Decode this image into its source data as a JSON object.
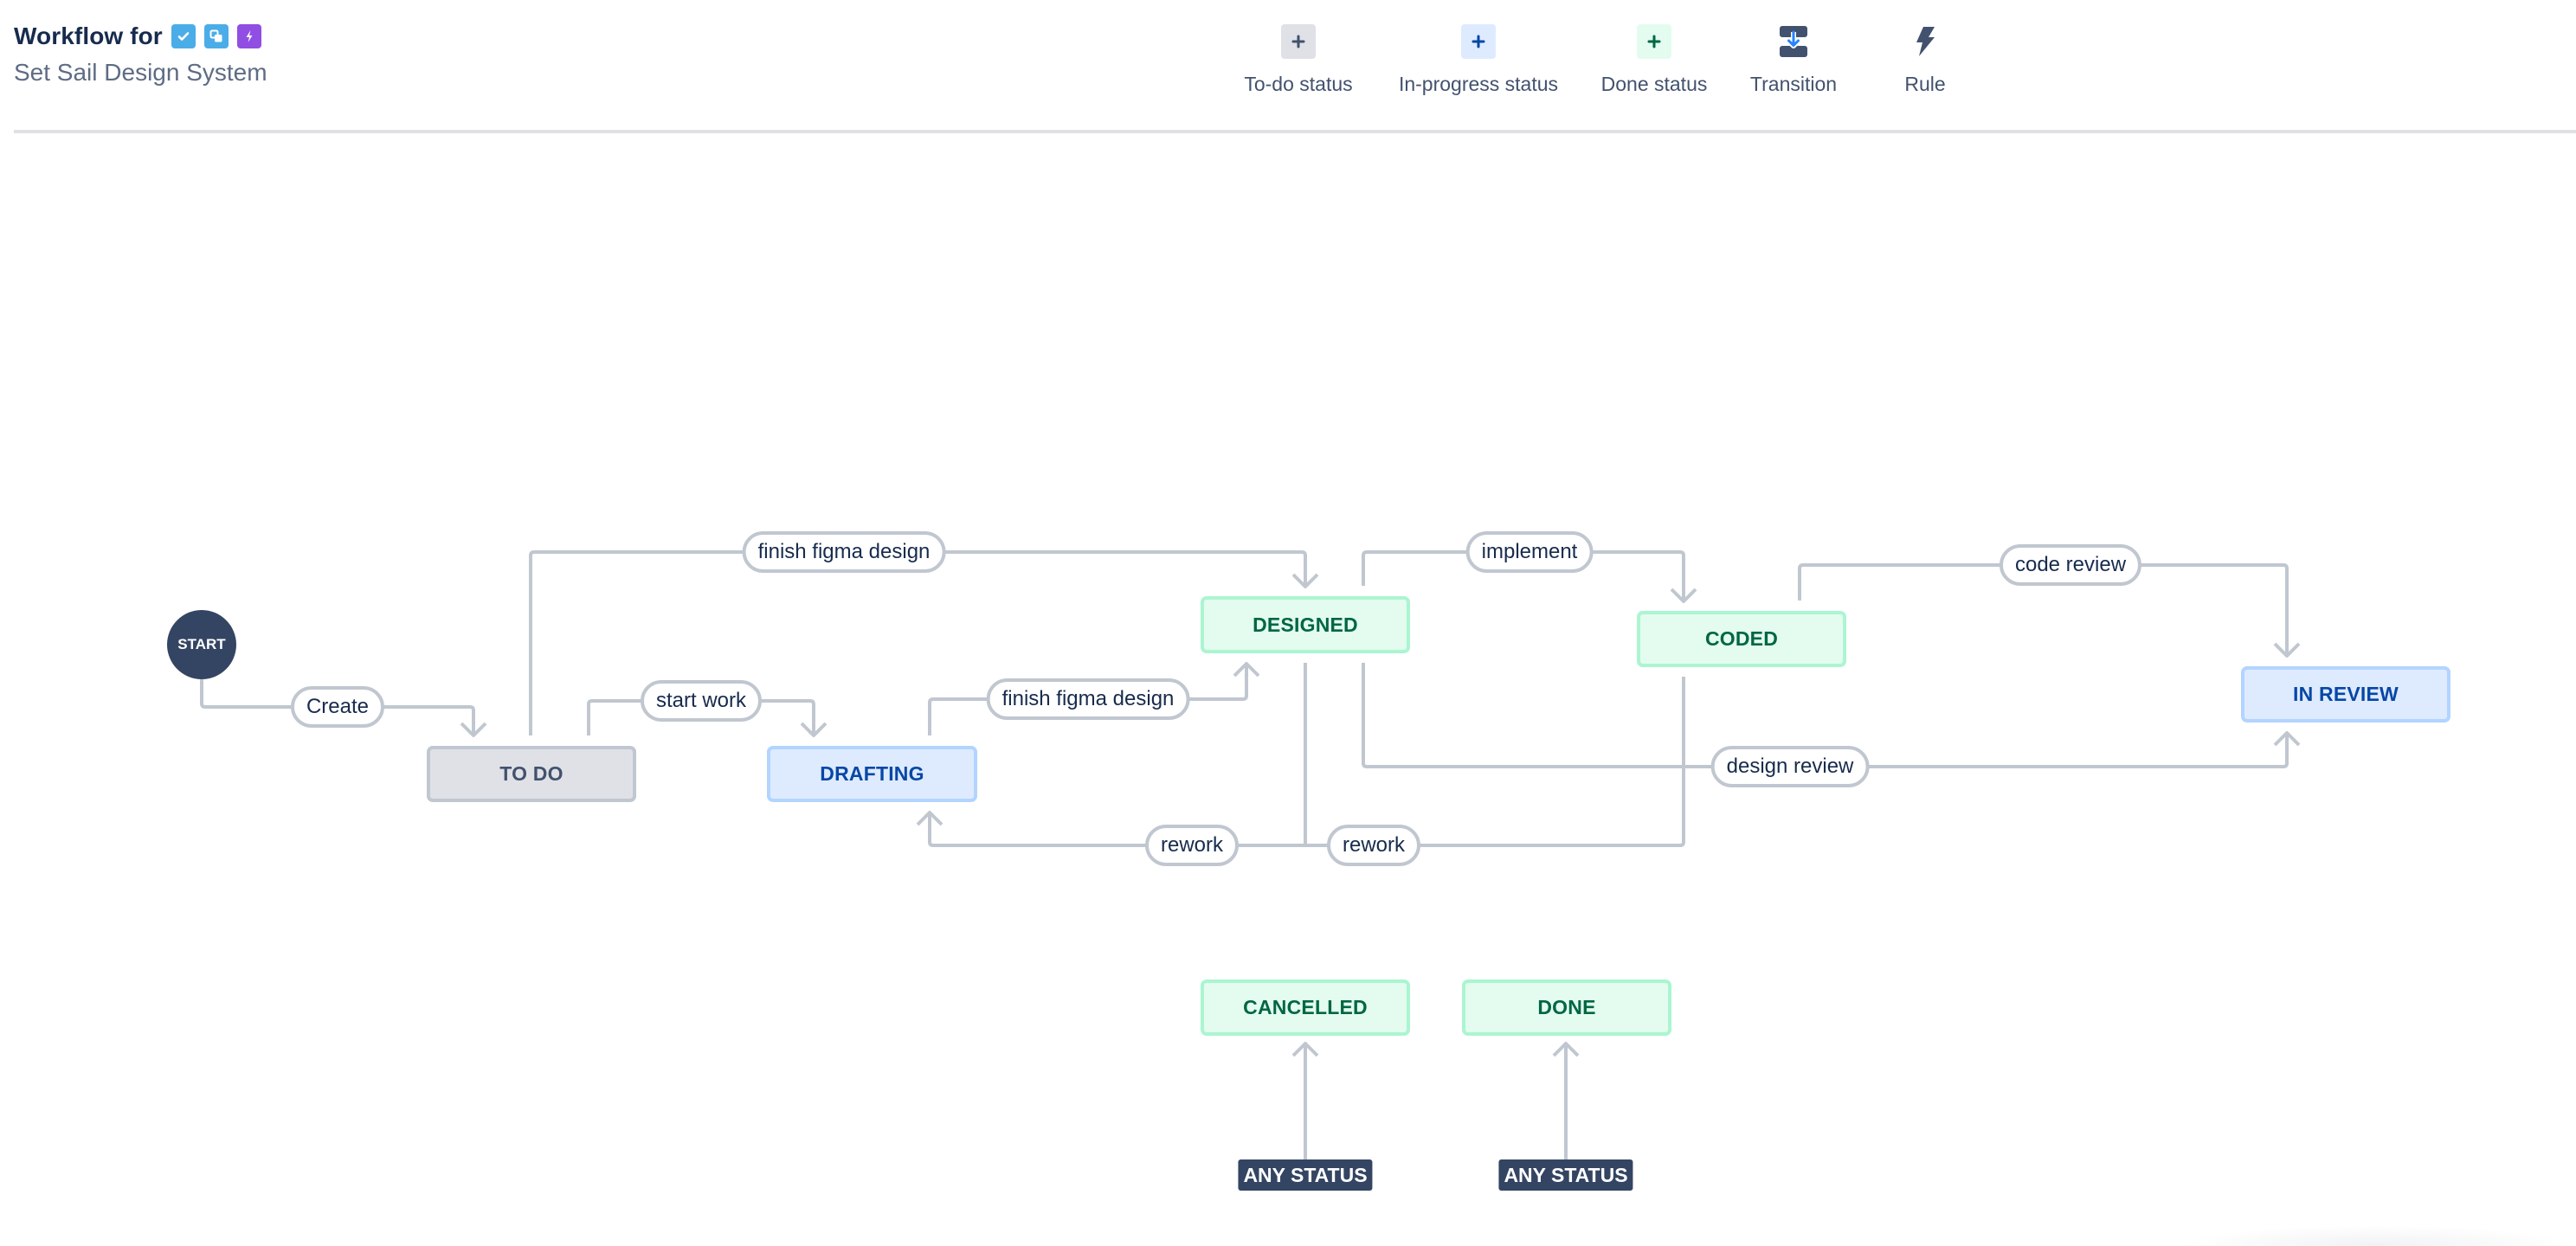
{
  "header": {
    "title": "Workflow for",
    "issue_type_icons": [
      {
        "name": "task-icon",
        "color": "#4bade8"
      },
      {
        "name": "subtask-icon",
        "color": "#4bade8"
      },
      {
        "name": "epic-icon",
        "color": "#904ee2"
      }
    ],
    "subtitle": "Set Sail Design System"
  },
  "toolbar": {
    "items": [
      {
        "label": "To-do status",
        "icon": "plus-icon",
        "icon_bg": "#dfe1e6",
        "icon_color": "#42526e"
      },
      {
        "label": "In-progress status",
        "icon": "plus-icon",
        "icon_bg": "#deebff",
        "icon_color": "#0747a6"
      },
      {
        "label": "Done status",
        "icon": "plus-icon",
        "icon_bg": "#e3fcef",
        "icon_color": "#006644"
      },
      {
        "label": "Transition",
        "icon": "transition-icon"
      },
      {
        "label": "Rule",
        "icon": "lightning-icon"
      }
    ]
  },
  "workflow": {
    "start_label": "START",
    "statuses": {
      "todo": {
        "label": "TO DO",
        "category": "to-do"
      },
      "drafting": {
        "label": "DRAFTING",
        "category": "in-progress"
      },
      "designed": {
        "label": "DESIGNED",
        "category": "done"
      },
      "coded": {
        "label": "CODED",
        "category": "done"
      },
      "in_review": {
        "label": "IN REVIEW",
        "category": "in-progress"
      },
      "cancelled": {
        "label": "CANCELLED",
        "category": "done"
      },
      "done": {
        "label": "DONE",
        "category": "done"
      }
    },
    "transitions": [
      {
        "label": "Create",
        "from": "START",
        "to": "TO DO"
      },
      {
        "label": "finish figma design",
        "from": "TO DO",
        "to": "DESIGNED"
      },
      {
        "label": "start work",
        "from": "TO DO",
        "to": "DRAFTING"
      },
      {
        "label": "finish figma design",
        "from": "DRAFTING",
        "to": "DESIGNED"
      },
      {
        "label": "implement",
        "from": "DESIGNED",
        "to": "CODED"
      },
      {
        "label": "code review",
        "from": "CODED",
        "to": "IN REVIEW"
      },
      {
        "label": "design review",
        "from": "DESIGNED",
        "to": "IN REVIEW"
      },
      {
        "label": "rework",
        "from": "DESIGNED",
        "to": "DRAFTING"
      },
      {
        "label": "rework",
        "from": "CODED",
        "to": "DRAFTING"
      }
    ],
    "global_transitions": [
      {
        "label": "ANY STATUS",
        "to": "CANCELLED"
      },
      {
        "label": "ANY STATUS",
        "to": "DONE"
      }
    ]
  },
  "colors": {
    "line": "#c1c7d0",
    "todo_bg": "#dfe1e6",
    "inprogress_bg": "#deebff",
    "done_bg": "#e3fcef",
    "node_dark": "#344563"
  }
}
